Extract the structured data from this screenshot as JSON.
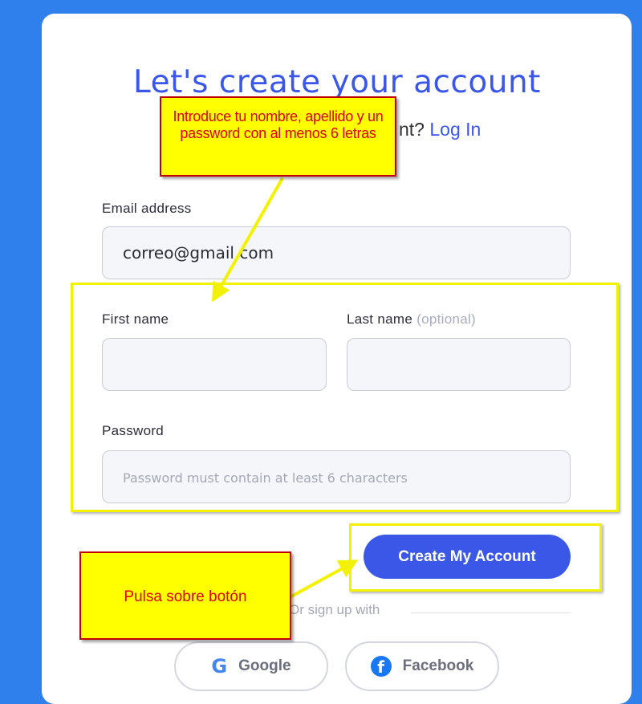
{
  "form": {
    "title": "Let's create your account",
    "subtitle_text": "nt?",
    "login_link": "Log In",
    "email_label": "Email address",
    "email_value": "correo@gmail.com",
    "first_name_label": "First name",
    "last_name_label": "Last name",
    "last_name_optional": "(optional)",
    "password_label": "Password",
    "password_placeholder": "Password must contain at least 6 characters",
    "create_button": "Create My Account",
    "divider_text": "Or sign up with",
    "google_label": "Google",
    "facebook_label": "Facebook"
  },
  "annotations": {
    "top_callout": "Introduce tu nombre, apellido y un password con al menos 6 letras",
    "bottom_callout": "Pulsa sobre botón"
  },
  "colors": {
    "background": "#2f80ed",
    "accent": "#3a57e8",
    "callout_fill": "#ffff00",
    "callout_border": "#c00000",
    "highlight": "#f2f200"
  },
  "icons": {
    "google": "google-icon",
    "facebook": "facebook-icon"
  }
}
